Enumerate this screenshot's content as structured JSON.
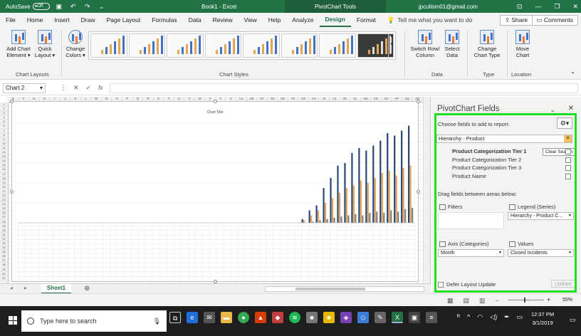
{
  "titlebar": {
    "autosave_label": "AutoSave",
    "autosave_state": "Off",
    "doc_title": "Book1 - Excel",
    "context_title": "PivotChart Tools",
    "user": "jpcullom01@gmail.com"
  },
  "tabs": [
    "File",
    "Home",
    "Insert",
    "Draw",
    "Page Layout",
    "Formulas",
    "Data",
    "Review",
    "View",
    "Help",
    "Analyze",
    "Design",
    "Format"
  ],
  "active_tab": "Design",
  "tellme": "Tell me what you want to do",
  "share_label": "Share",
  "comments_label": "Comments",
  "ribbon": {
    "add_chart_element": "Add Chart Element",
    "quick_layout": "Quick Layout",
    "change_colors": "Change Colors",
    "chart_layouts_group": "Chart Layouts",
    "chart_styles_group": "Chart Styles",
    "switch_row_column": "Switch Row/ Column",
    "select_data": "Select Data",
    "data_group": "Data",
    "change_chart_type": "Change Chart Type",
    "type_group": "Type",
    "move_chart": "Move Chart",
    "location_group": "Location"
  },
  "formula_bar": {
    "name_box": "Chart 2",
    "fx": "fx"
  },
  "chart": {
    "title": "Chart Title"
  },
  "chart_data": {
    "type": "bar",
    "title": "Chart Title",
    "series": [
      {
        "name": "",
        "color": "#264478",
        "values": [
          0,
          0,
          0,
          0,
          0,
          0,
          0,
          0,
          0,
          0,
          0,
          0,
          0,
          0,
          0,
          0,
          0,
          0,
          0,
          0,
          0,
          0,
          0,
          0,
          0,
          0,
          0,
          0,
          0,
          0,
          0,
          0,
          0,
          0,
          0,
          0,
          0,
          0,
          0,
          0,
          3,
          10,
          14,
          28,
          36,
          46,
          48,
          56,
          60,
          58,
          62,
          66,
          72,
          70,
          74,
          78
        ]
      },
      {
        "name": "",
        "color": "#e6a552",
        "values": [
          0,
          0,
          0,
          0,
          0,
          0,
          0,
          0,
          0,
          0,
          0,
          0,
          0,
          0,
          0,
          0,
          0,
          0,
          0,
          0,
          0,
          0,
          0,
          0,
          0,
          0,
          0,
          0,
          0,
          0,
          0,
          0,
          0,
          0,
          0,
          0,
          0,
          0,
          0,
          0,
          2,
          6,
          10,
          16,
          20,
          24,
          28,
          30,
          34,
          32,
          36,
          40,
          42,
          38,
          44,
          46
        ]
      },
      {
        "name": "",
        "color": "#7f7f7f",
        "values": [
          0,
          0,
          0,
          0,
          0,
          0,
          0,
          0,
          0,
          0,
          0,
          0,
          0,
          0,
          0,
          0,
          0,
          0,
          0,
          0,
          0,
          0,
          0,
          0,
          0,
          0,
          0,
          0,
          0,
          0,
          0,
          0,
          0,
          0,
          0,
          0,
          0,
          0,
          0,
          0,
          0,
          1,
          2,
          3,
          4,
          5,
          6,
          7,
          6,
          8,
          9,
          8,
          10,
          9,
          11,
          12
        ]
      }
    ],
    "ylim": [
      0,
      80
    ],
    "grid": true
  },
  "sheet_tab": "Sheet1",
  "pane": {
    "title": "PivotChart Fields",
    "choose_label": "Choose fields to add to report:",
    "search_value": "Hierarchy - Product",
    "clear_search": "Clear Search",
    "fields": [
      "Product Categorization Tier 1",
      "Product Categorization Tier 2",
      "Product Categorization Tier 3",
      "Product Name"
    ],
    "drag_label": "Drag fields between areas below:",
    "filters_label": "Filters",
    "legend_label": "Legend (Series)",
    "legend_value": "Hierarchy - Product C...",
    "axis_label": "Axis (Categories)",
    "axis_value": "Month",
    "values_label": "Values",
    "values_value": "Closed Incidents",
    "defer_label": "Defer Layout Update",
    "update_label": "Update"
  },
  "status": {
    "zoom": "55%"
  },
  "taskbar": {
    "search_placeholder": "Type here to search",
    "time": "12:37 PM",
    "date": "3/1/2019"
  }
}
